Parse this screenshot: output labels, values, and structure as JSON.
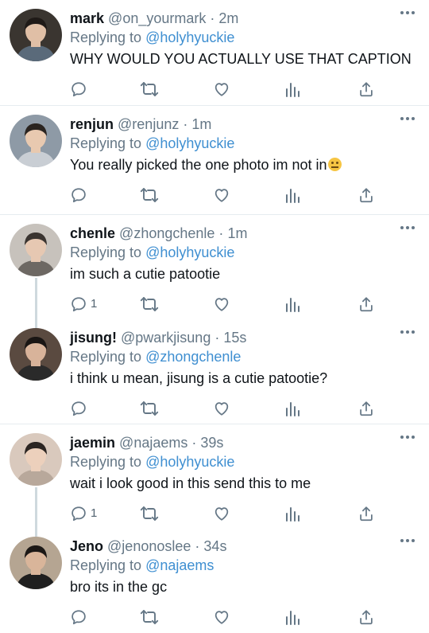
{
  "colors": {
    "accent": "#3f8fd1",
    "muted": "#657786",
    "text": "#0f1419",
    "divider": "#e6ecf0"
  },
  "icons": [
    "reply-icon",
    "retweet-icon",
    "like-icon",
    "analytics-icon",
    "share-icon",
    "more-icon"
  ],
  "tweets": [
    {
      "name": "mark",
      "handle": "@on_yourmark",
      "dot": "·",
      "time": "2m",
      "replying_label": "Replying to",
      "replying_to": "@holyhyuckie",
      "text": "WHY WOULD YOU ACTUALLY USE THAT CAPTION",
      "reply_count": ""
    },
    {
      "name": "renjun",
      "handle": "@renjunz",
      "dot": "·",
      "time": "1m",
      "replying_label": "Replying to",
      "replying_to": "@holyhyuckie",
      "text": "You really picked the one photo im not in",
      "emoji": "neutral-face-emoji",
      "reply_count": ""
    },
    {
      "name": "chenle",
      "handle": "@zhongchenle",
      "dot": "·",
      "time": "1m",
      "replying_label": "Replying to",
      "replying_to": "@holyhyuckie",
      "text": "im such a cutie patootie",
      "reply_count": "1"
    },
    {
      "name": "jisung!",
      "handle": "@pwarkjisung",
      "dot": "·",
      "time": "15s",
      "replying_label": "Replying to",
      "replying_to": "@zhongchenle",
      "text": "i think u mean, jisung is a cutie patootie?",
      "reply_count": ""
    },
    {
      "name": "jaemin",
      "handle": "@najaems",
      "dot": "·",
      "time": "39s",
      "replying_label": "Replying to",
      "replying_to": "@holyhyuckie",
      "text": "wait i look good in this send this to me",
      "reply_count": "1"
    },
    {
      "name": "Jeno",
      "handle": "@jenonoslee",
      "dot": "·",
      "time": "34s",
      "replying_label": "Replying to",
      "replying_to": "@najaems",
      "text": "bro its in the gc",
      "reply_count": ""
    }
  ]
}
